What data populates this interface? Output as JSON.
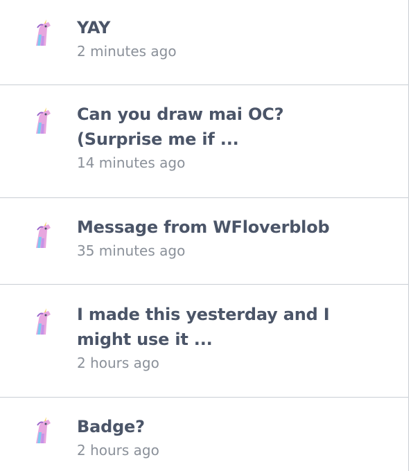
{
  "notifications": [
    {
      "title": "YAY",
      "time": "2 minutes ago"
    },
    {
      "title": "Can you draw mai OC?\n(Surprise me if ...",
      "time": "14 minutes ago"
    },
    {
      "title": "Message from WFloverblob",
      "time": "35 minutes ago"
    },
    {
      "title": "I made this yesterday and I\nmight use it ...",
      "time": "2 hours ago"
    },
    {
      "title": "Badge?",
      "time": "2 hours ago"
    }
  ]
}
